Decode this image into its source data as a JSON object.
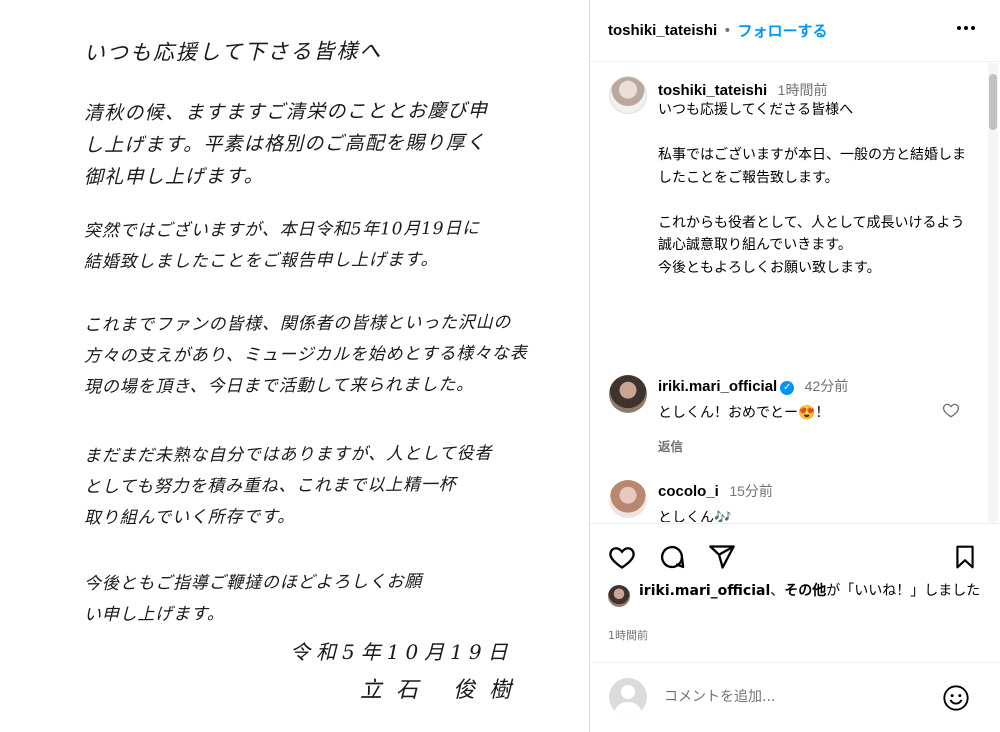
{
  "letter": {
    "greeting": "いつも応援して下さる皆様へ",
    "p1": [
      "清秋の候、ますますご清栄のこととお慶び申",
      "し上げます。平素は格別のご高配を賜り厚く",
      "御礼申し上げます。"
    ],
    "p2": [
      "突然ではございますが、本日令和5年10月19日に",
      "結婚致しましたことをご報告申し上げます。"
    ],
    "p3": [
      "これまでファンの皆様、関係者の皆様といった沢山の",
      "方々の支えがあり、ミュージカルを始めとする様々な表",
      "現の場を頂き、今日まで活動して来られました。"
    ],
    "p4": [
      "まだまだ未熟な自分ではありますが、人として役者",
      "としても努力を積み重ね、これまで以上精一杯",
      "取り組んでいく所存です。"
    ],
    "p5": [
      "今後ともご指導ご鞭撻のほどよろしくお願",
      "い申し上げます。"
    ],
    "date": "令和5年10月19日",
    "signature": "立石 俊樹"
  },
  "header": {
    "username": "toshiki_tateishi",
    "separator": "•",
    "follow_label": "フォローする",
    "more_icon": "more-horizontal-icon"
  },
  "post": {
    "username": "toshiki_tateishi",
    "time": "1時間前",
    "caption": "いつも応援してくださる皆様へ\n\n私事ではございますが本日、一般の方と結婚しましたことをご報告致します。\n\nこれからも役者として、人として成長いけるよう誠心誠意取り組んでいきます。\n今後ともよろしくお願い致します。"
  },
  "comments": [
    {
      "username": "iriki.mari_official",
      "verified": true,
      "time": "42分前",
      "text": "としくん！おめでとー😍！",
      "reply_label": "返信"
    },
    {
      "username": "cocolo_i",
      "verified": false,
      "time": "15分前",
      "text": "としくん🎶"
    }
  ],
  "likes": {
    "user": "iriki.mari_official",
    "middle": "、",
    "others": "その他",
    "suffix": "が「いいね！」しました"
  },
  "post_time": "1時間前",
  "comment_input": {
    "placeholder": "コメントを追加..."
  },
  "colors": {
    "accent": "#0095f6",
    "secondary_text": "#737373",
    "border": "#dbdbdb"
  }
}
